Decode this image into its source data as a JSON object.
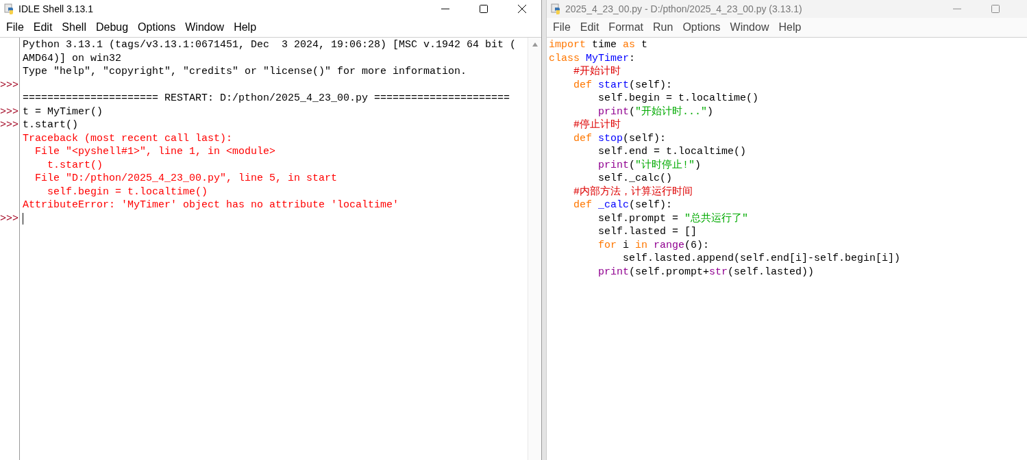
{
  "shell_window": {
    "title": "IDLE Shell 3.13.1",
    "menu": [
      "File",
      "Edit",
      "Shell",
      "Debug",
      "Options",
      "Window",
      "Help"
    ],
    "lines": [
      {
        "segments": [
          {
            "text": "Python 3.13.1 (tags/v3.13.1:0671451, Dec  3 2024, 19:06:28) [MSC v.1942 64 bit (",
            "kind": "plain"
          }
        ]
      },
      {
        "segments": [
          {
            "text": "AMD64)] on win32",
            "kind": "plain"
          }
        ]
      },
      {
        "segments": [
          {
            "text": "Type \"help\", \"copyright\", \"credits\" or \"license()\" for more information.",
            "kind": "plain"
          }
        ]
      },
      {
        "prompt": ">>>"
      },
      {
        "segments": [
          {
            "text": "====================== RESTART: D:/pthon/2025_4_23_00.py ======================",
            "kind": "plain"
          }
        ]
      },
      {
        "prompt": ">>>",
        "segments": [
          {
            "text": "t = MyTimer()",
            "kind": "plain"
          }
        ]
      },
      {
        "prompt": ">>>",
        "segments": [
          {
            "text": "t.start()",
            "kind": "plain"
          }
        ]
      },
      {
        "segments": [
          {
            "text": "Traceback (most recent call last):",
            "kind": "error"
          }
        ]
      },
      {
        "segments": [
          {
            "text": "  File \"<pyshell#1>\", line 1, in <module>",
            "kind": "error"
          }
        ]
      },
      {
        "segments": [
          {
            "text": "    t.start()",
            "kind": "error"
          }
        ]
      },
      {
        "segments": [
          {
            "text": "  File \"D:/pthon/2025_4_23_00.py\", line 5, in start",
            "kind": "error"
          }
        ]
      },
      {
        "segments": [
          {
            "text": "    self.begin = t.localtime()",
            "kind": "error"
          }
        ]
      },
      {
        "segments": [
          {
            "text": "AttributeError: 'MyTimer' object has no attribute 'localtime'",
            "kind": "error"
          }
        ]
      },
      {
        "prompt": ">>>",
        "cursor": true
      }
    ]
  },
  "editor_window": {
    "title": "2025_4_23_00.py - D:/pthon/2025_4_23_00.py (3.13.1)",
    "menu": [
      "File",
      "Edit",
      "Format",
      "Run",
      "Options",
      "Window",
      "Help"
    ],
    "lines": [
      {
        "segments": [
          {
            "text": "import",
            "kind": "keyword"
          },
          {
            "text": " time ",
            "kind": "plain"
          },
          {
            "text": "as",
            "kind": "keyword"
          },
          {
            "text": " t",
            "kind": "plain"
          }
        ]
      },
      {
        "segments": [
          {
            "text": "class ",
            "kind": "keyword"
          },
          {
            "text": "MyTimer",
            "kind": "definition"
          },
          {
            "text": ":",
            "kind": "plain"
          }
        ]
      },
      {
        "segments": [
          {
            "text": "    #开始计时",
            "kind": "comment"
          }
        ]
      },
      {
        "segments": [
          {
            "text": "    def ",
            "kind": "keyword"
          },
          {
            "text": "start",
            "kind": "definition"
          },
          {
            "text": "(self):",
            "kind": "plain"
          }
        ]
      },
      {
        "segments": [
          {
            "text": "        self.begin = t.localtime()",
            "kind": "plain"
          }
        ]
      },
      {
        "segments": [
          {
            "text": "        print",
            "kind": "builtin"
          },
          {
            "text": "(",
            "kind": "plain"
          },
          {
            "text": "\"开始计时...\"",
            "kind": "string"
          },
          {
            "text": ")",
            "kind": "plain"
          }
        ]
      },
      {
        "segments": [
          {
            "text": "    #停止计时",
            "kind": "comment"
          }
        ]
      },
      {
        "segments": [
          {
            "text": "    def ",
            "kind": "keyword"
          },
          {
            "text": "stop",
            "kind": "definition"
          },
          {
            "text": "(self):",
            "kind": "plain"
          }
        ]
      },
      {
        "segments": [
          {
            "text": "        self.end = t.localtime()",
            "kind": "plain"
          }
        ]
      },
      {
        "segments": [
          {
            "text": "        print",
            "kind": "builtin"
          },
          {
            "text": "(",
            "kind": "plain"
          },
          {
            "text": "\"计时停止!\"",
            "kind": "string"
          },
          {
            "text": ")",
            "kind": "plain"
          }
        ]
      },
      {
        "segments": [
          {
            "text": "        self._calc()",
            "kind": "plain"
          }
        ]
      },
      {
        "segments": [
          {
            "text": "    #内部方法，计算运行时间",
            "kind": "comment"
          }
        ]
      },
      {
        "segments": [
          {
            "text": "    def ",
            "kind": "keyword"
          },
          {
            "text": "_calc",
            "kind": "definition"
          },
          {
            "text": "(self):",
            "kind": "plain"
          }
        ]
      },
      {
        "segments": [
          {
            "text": "        self.prompt = ",
            "kind": "plain"
          },
          {
            "text": "\"总共运行了\"",
            "kind": "string"
          }
        ]
      },
      {
        "segments": [
          {
            "text": "        self.lasted = []",
            "kind": "plain"
          }
        ]
      },
      {
        "segments": [
          {
            "text": "        for",
            "kind": "keyword"
          },
          {
            "text": " i ",
            "kind": "plain"
          },
          {
            "text": "in",
            "kind": "keyword"
          },
          {
            "text": " range",
            "kind": "builtin"
          },
          {
            "text": "(6):",
            "kind": "plain"
          }
        ]
      },
      {
        "segments": [
          {
            "text": "            self.lasted.append(self.end[i]-self.begin[i])",
            "kind": "plain"
          }
        ]
      },
      {
        "segments": [
          {
            "text": "        print",
            "kind": "builtin"
          },
          {
            "text": "(self.prompt+",
            "kind": "plain"
          },
          {
            "text": "str",
            "kind": "builtin"
          },
          {
            "text": "(self.lasted))",
            "kind": "plain"
          }
        ]
      }
    ]
  }
}
